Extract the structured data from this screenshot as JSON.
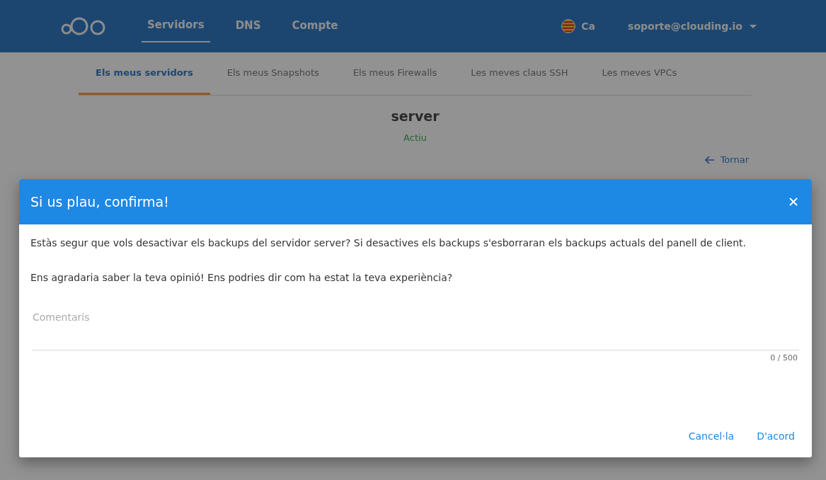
{
  "header": {
    "nav": [
      {
        "label": "Servidors",
        "selected": true
      },
      {
        "label": "DNS",
        "selected": false
      },
      {
        "label": "Compte",
        "selected": false
      }
    ],
    "language": "Ca",
    "account": "soporte@clouding.io"
  },
  "subtabs": [
    {
      "label": "Els meus servidors",
      "selected": true
    },
    {
      "label": "Els meus Snapshots",
      "selected": false
    },
    {
      "label": "Els meus Firewalls",
      "selected": false
    },
    {
      "label": "Les meves claus SSH",
      "selected": false
    },
    {
      "label": "Les meves VPCs",
      "selected": false
    }
  ],
  "server": {
    "name": "server",
    "status": "Actiu"
  },
  "back_link": "Tornar",
  "dialog": {
    "title": "Si us plau, confirma!",
    "paragraphs": [
      "Estàs segur que vols desactivar els backups del servidor server? Si desactives els backups s'esborraran els backups actuals del panell de client.",
      "Ens agradaria saber la teva opinió! Ens podries dir com ha estat la teva experiència?"
    ],
    "comment_field": {
      "placeholder": "Comentaris",
      "counter": "0 / 500"
    },
    "buttons": [
      "Cancel·la",
      "D'acord"
    ]
  }
}
